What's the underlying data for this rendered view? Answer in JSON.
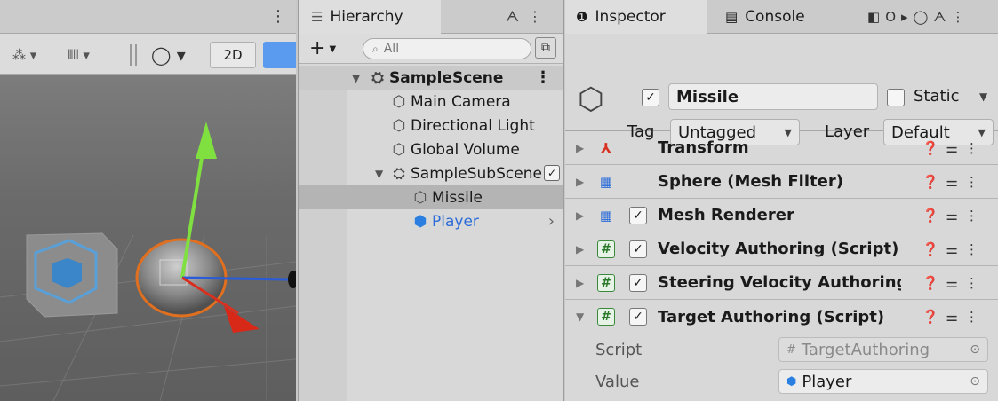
{
  "scene": {
    "toggle_2d": "2D"
  },
  "hierarchy": {
    "tab_label": "Hierarchy",
    "search_placeholder": "All",
    "items": [
      {
        "label": "SampleScene"
      },
      {
        "label": "Main Camera"
      },
      {
        "label": "Directional Light"
      },
      {
        "label": "Global Volume"
      },
      {
        "label": "SampleSubScene"
      },
      {
        "label": "Missile"
      },
      {
        "label": "Player"
      }
    ]
  },
  "inspector": {
    "tabs": [
      "Inspector",
      "Console",
      "O"
    ],
    "object_name": "Missile",
    "static_label": "Static",
    "tag_label": "Tag",
    "tag_value": "Untagged",
    "layer_label": "Layer",
    "layer_value": "Default",
    "components": [
      {
        "name": "Transform"
      },
      {
        "name": "Sphere (Mesh Filter)"
      },
      {
        "name": "Mesh Renderer"
      },
      {
        "name": "Velocity Authoring (Script)"
      },
      {
        "name": "Steering Velocity Authoring (Script)"
      },
      {
        "name": "Target Authoring (Script)"
      }
    ],
    "properties": [
      {
        "label": "Script",
        "value": "TargetAuthoring"
      },
      {
        "label": "Value",
        "value": "Player"
      }
    ]
  }
}
